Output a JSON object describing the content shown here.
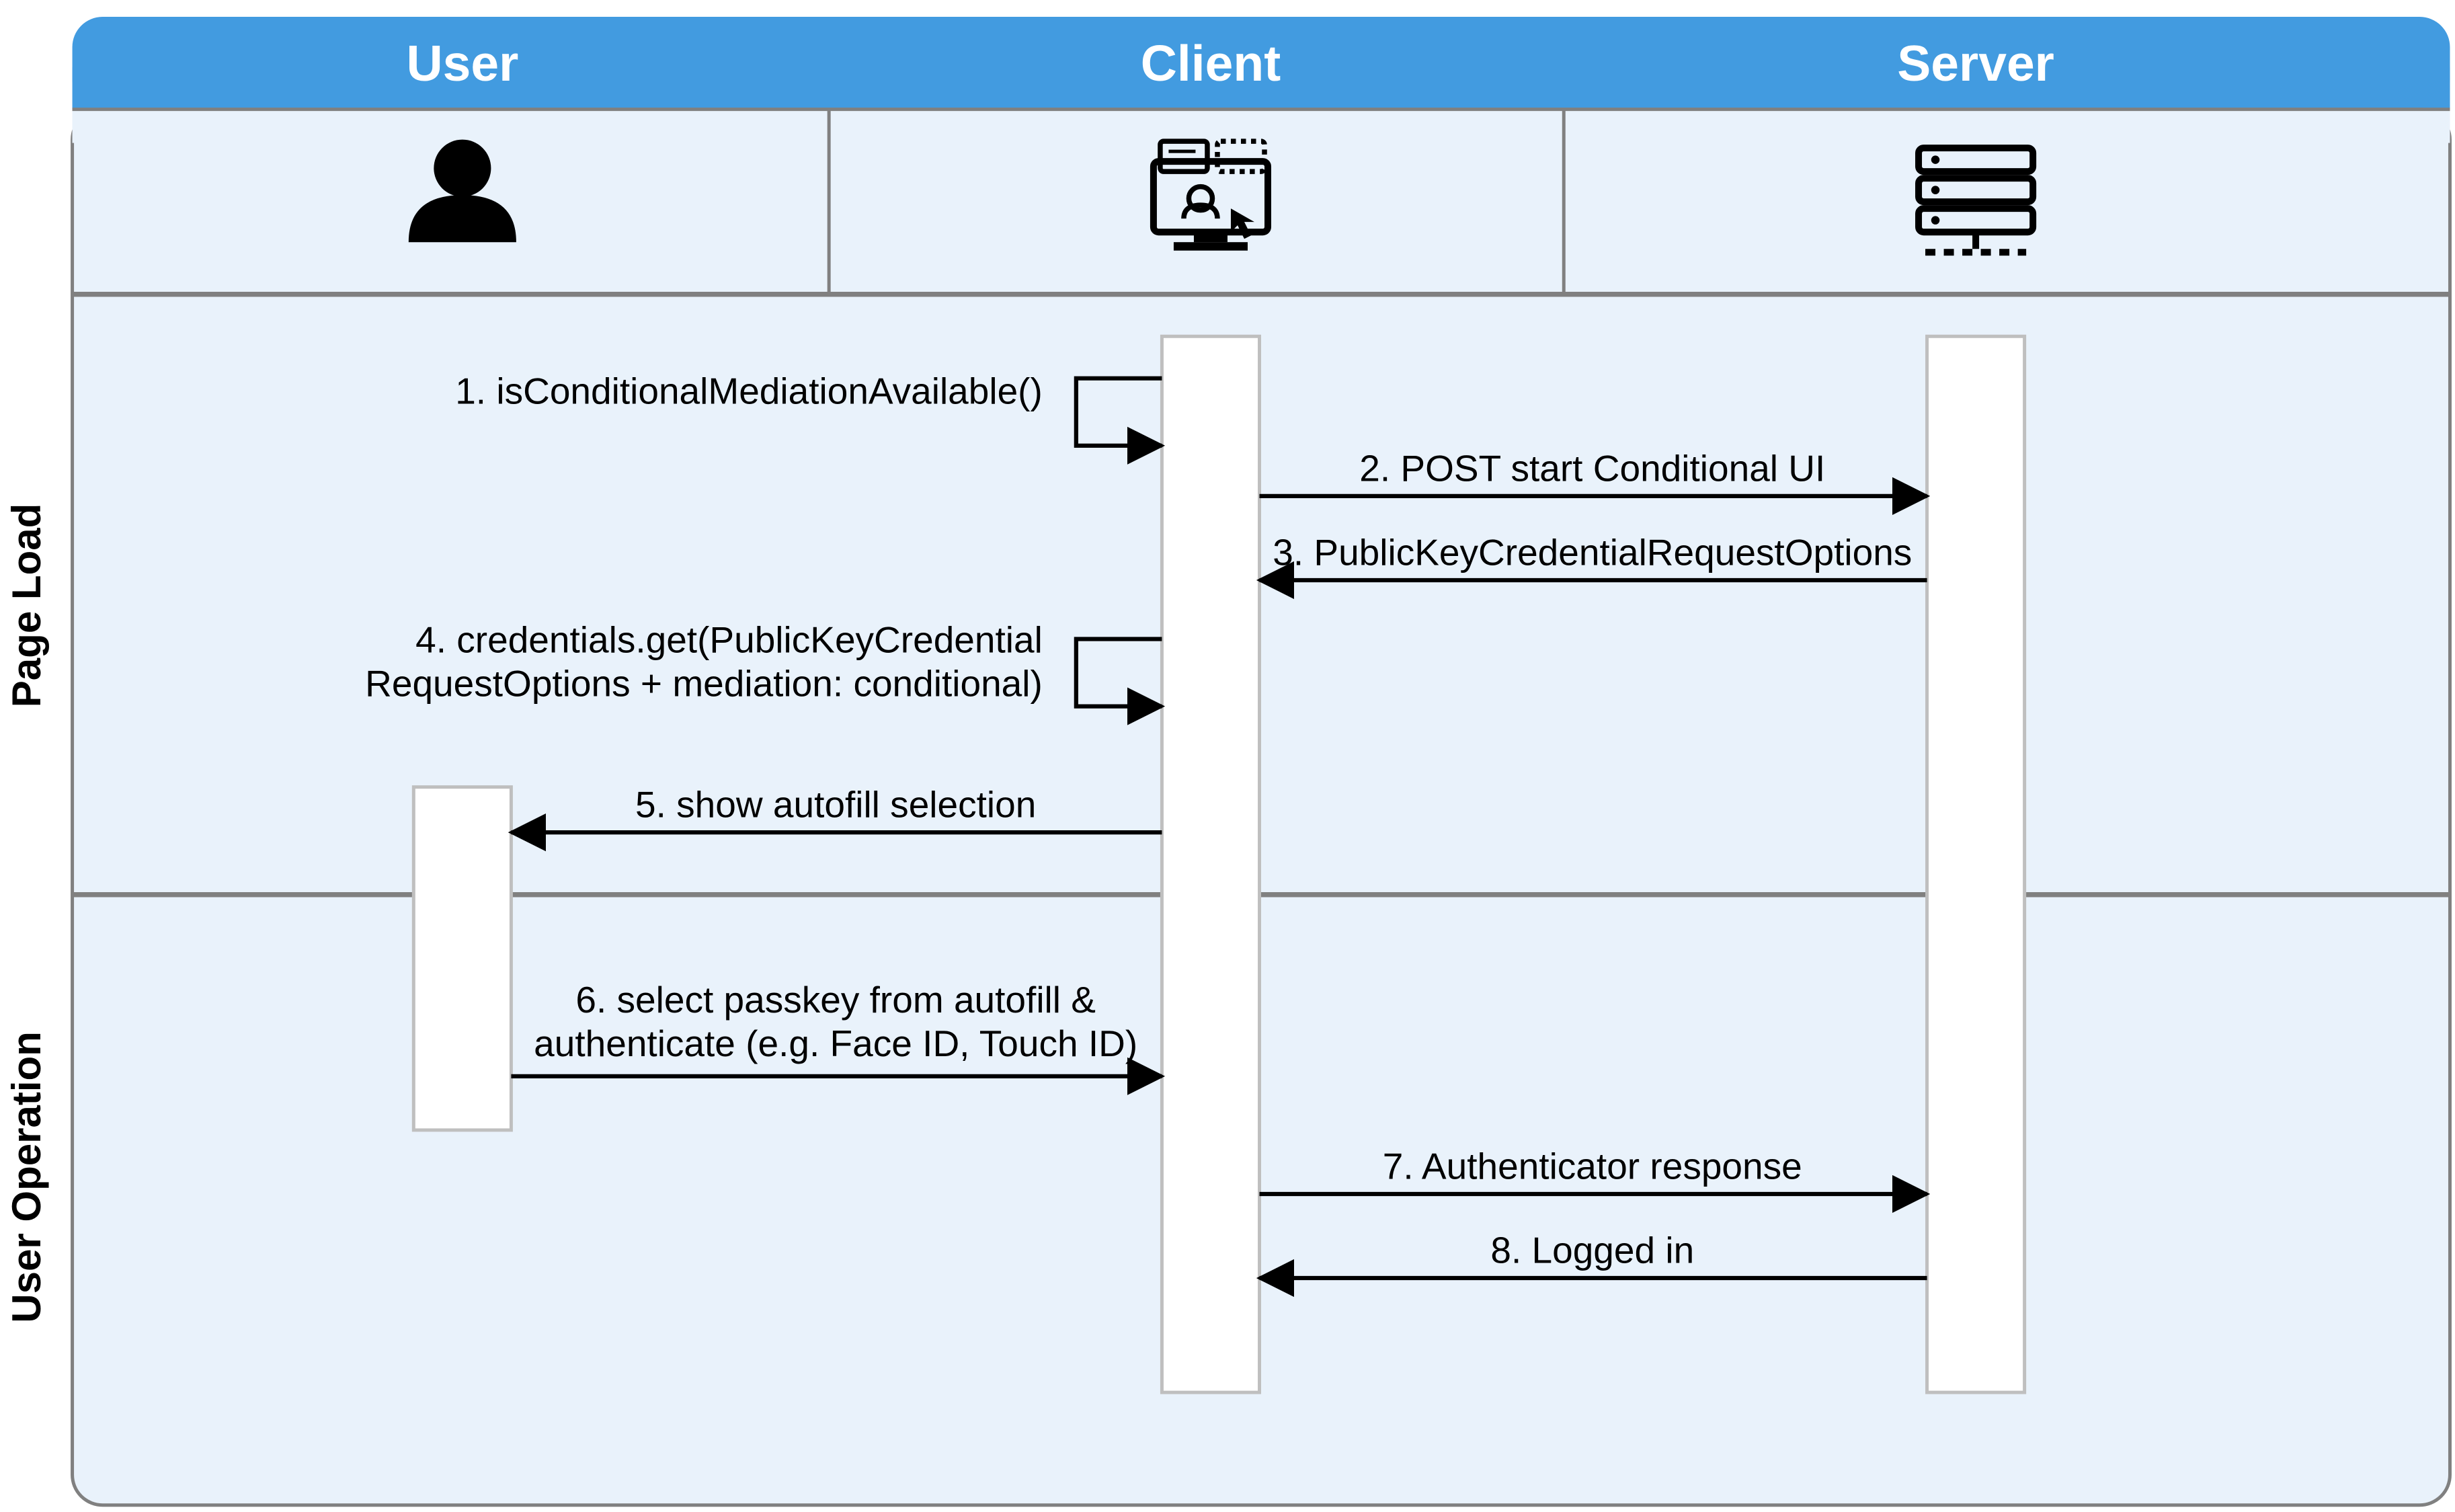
{
  "colors": {
    "header_fill": "#429be0",
    "lane_fill": "#e9f2fb",
    "box_fill": "#ffffff",
    "line": "#000000",
    "grid": "#808080",
    "header_text": "#ffffff",
    "body_text": "#000000"
  },
  "lanes": {
    "user": "User",
    "client": "Client",
    "server": "Server"
  },
  "phases": {
    "page_load": "Page Load",
    "user_operation": "User Operation"
  },
  "messages": {
    "m1": "1. isConditionalMediationAvailable()",
    "m2": "2. POST start Conditional UI",
    "m3": "3. PublicKeyCredentialRequestOptions",
    "m4a": "4. credentials.get(PublicKeyCredential",
    "m4b": "RequestOptions + mediation: conditional)",
    "m5": "5. show autofill selection",
    "m6a": "6. select passkey from autofill &",
    "m6b": "authenticate (e.g. Face ID, Touch ID)",
    "m7": "7. Authenticator response",
    "m8": "8. Logged in"
  }
}
